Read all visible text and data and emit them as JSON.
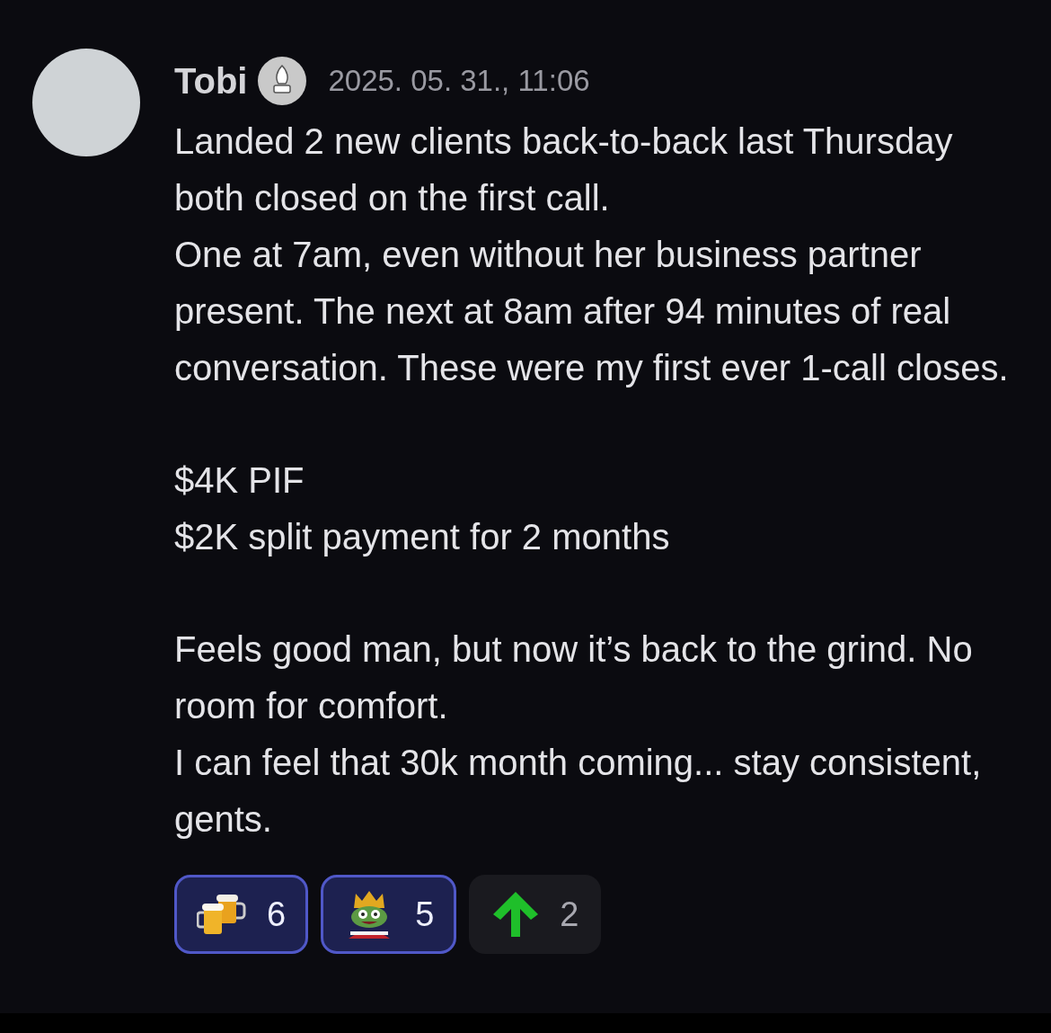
{
  "message": {
    "author": "Tobi",
    "timestamp": "2025. 05. 31., 11:06",
    "paragraphs": [
      {
        "lines": [
          "Landed 2 new clients back-to-back last Thursday both closed on the first call.",
          "One at 7am, even without her business partner present. The next at 8am after 94 minutes of real conversation. These were my first ever 1-call closes."
        ]
      },
      {
        "lines": [
          "$4K PIF",
          "$2K split payment for 2 months"
        ]
      },
      {
        "lines": [
          "Feels good man, but now it’s back to the grind. No room for comfort.",
          "I can feel that 30k month coming... stay consistent, gents."
        ]
      }
    ],
    "reactions": [
      {
        "kind": "beers",
        "count": "6",
        "selected": true
      },
      {
        "kind": "frog-king",
        "count": "5",
        "selected": true
      },
      {
        "kind": "up-arrow",
        "count": "2",
        "selected": false
      }
    ]
  }
}
